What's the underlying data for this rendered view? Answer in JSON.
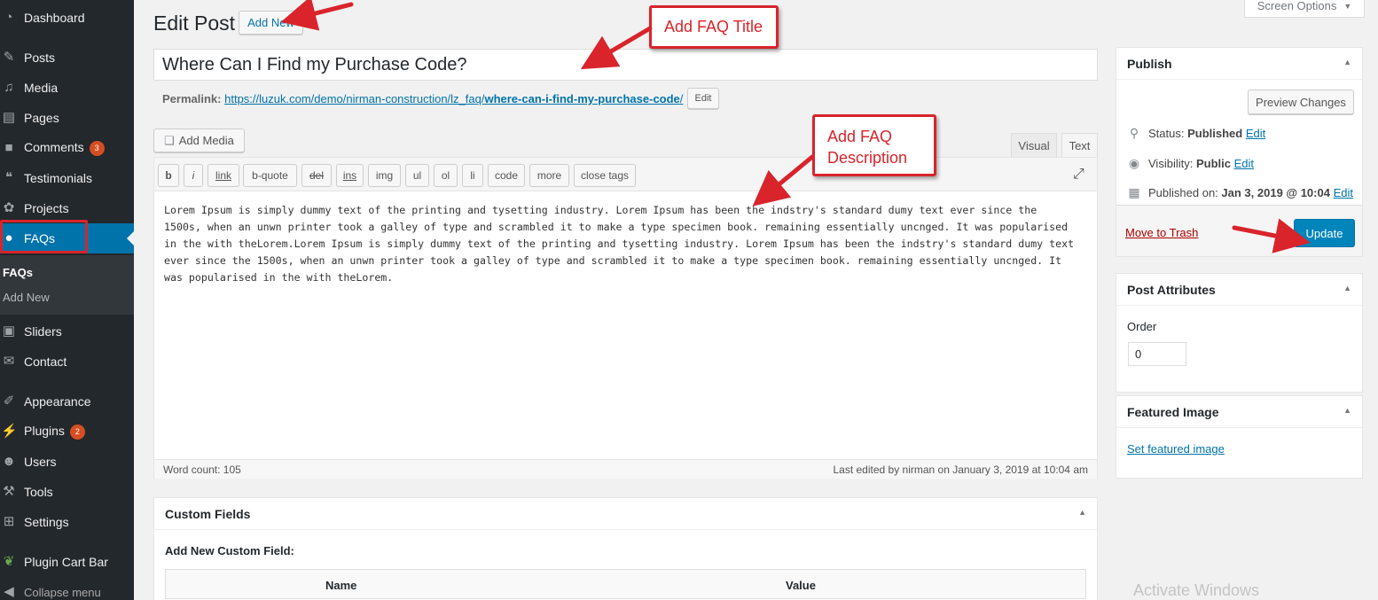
{
  "sidebar": {
    "items": [
      {
        "label": "Dashboard",
        "icon": "dashboard-icon",
        "badge": ""
      },
      {
        "label": "Posts",
        "icon": "pin-icon",
        "badge": ""
      },
      {
        "label": "Media",
        "icon": "media-icon",
        "badge": ""
      },
      {
        "label": "Pages",
        "icon": "pages-icon",
        "badge": ""
      },
      {
        "label": "Comments",
        "icon": "comments-icon",
        "badge": "3"
      },
      {
        "label": "Testimonials",
        "icon": "testimonials-icon",
        "badge": ""
      },
      {
        "label": "Projects",
        "icon": "projects-icon",
        "badge": ""
      },
      {
        "label": "FAQs",
        "icon": "faq-bubble-icon",
        "badge": ""
      },
      {
        "label": "Sliders",
        "icon": "sliders-icon",
        "badge": ""
      },
      {
        "label": "Contact",
        "icon": "envelope-icon",
        "badge": ""
      },
      {
        "label": "Appearance",
        "icon": "brush-icon",
        "badge": ""
      },
      {
        "label": "Plugins",
        "icon": "plug-icon",
        "badge": "2"
      },
      {
        "label": "Users",
        "icon": "user-icon",
        "badge": ""
      },
      {
        "label": "Tools",
        "icon": "wrench-icon",
        "badge": ""
      },
      {
        "label": "Settings",
        "icon": "settings-icon",
        "badge": ""
      },
      {
        "label": "Plugin Cart Bar",
        "icon": "leaf-icon",
        "badge": ""
      },
      {
        "label": "Collapse menu",
        "icon": "collapse-icon",
        "badge": ""
      }
    ],
    "submenu": [
      "FAQs",
      "Add New"
    ]
  },
  "header": {
    "title": "Edit Post",
    "add_new": "Add New",
    "screen_options": "Screen Options"
  },
  "post": {
    "title": "Where Can I Find my Purchase Code?",
    "permalink_label": "Permalink:",
    "permalink_base": "https://luzuk.com/demo/nirman-construction/lz_faq/",
    "permalink_slug": "where-can-i-find-my-purchase-code",
    "permalink_trail": "/",
    "permalink_edit": "Edit"
  },
  "editor": {
    "add_media": "Add Media",
    "tab_visual": "Visual",
    "tab_text": "Text",
    "quicktags": [
      "b",
      "i",
      "link",
      "b-quote",
      "del",
      "ins",
      "img",
      "ul",
      "ol",
      "li",
      "code",
      "more",
      "close tags"
    ],
    "content": "Lorem Ipsum is simply dummy text of the printing and tysetting industry. Lorem Ipsum has been the indstry's standard dumy text ever since the 1500s, when an unwn printer took a galley of type and scrambled it to make a type specimen book. remaining essentially uncnged. It was popularised in the with theLorem.Lorem Ipsum is simply dummy text of the printing and tysetting industry. Lorem Ipsum has been the indstry's standard dumy text ever since the 1500s, when an unwn printer took a galley of type and scrambled it to make a type specimen book. remaining essentially uncnged. It was popularised in the with theLorem.",
    "word_count": "Word count: 105",
    "last_edited": "Last edited by nirman on January 3, 2019 at 10:04 am"
  },
  "custom_fields": {
    "title": "Custom Fields",
    "subtitle": "Add New Custom Field:",
    "col_name": "Name",
    "col_value": "Value"
  },
  "publish": {
    "title": "Publish",
    "preview": "Preview Changes",
    "status_label": "Status:",
    "status_value": "Published",
    "visibility_label": "Visibility:",
    "visibility_value": "Public",
    "published_label": "Published on:",
    "published_value": "Jan 3, 2019 @ 10:04",
    "edit": "Edit",
    "trash": "Move to Trash",
    "update": "Update"
  },
  "attributes": {
    "title": "Post Attributes",
    "order_label": "Order",
    "order_value": "0"
  },
  "featured": {
    "title": "Featured Image",
    "link": "Set featured image"
  },
  "annotations": {
    "title_callout": "Add FAQ Title",
    "desc_callout": "Add FAQ Description"
  },
  "watermark": "Activate Windows",
  "colors": {
    "sidebar_bg": "#23282d",
    "accent": "#0073aa",
    "update_button": "#0085ba",
    "annotation_red": "#d9242b",
    "badge": "#d54e21"
  }
}
